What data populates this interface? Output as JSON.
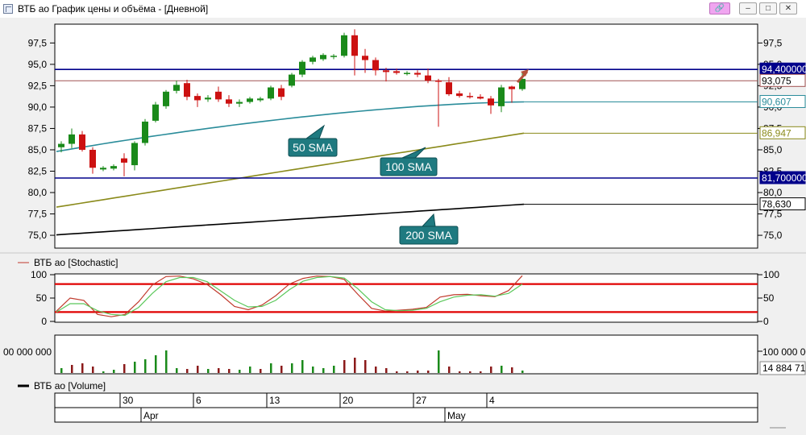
{
  "window": {
    "title": "ВТБ ао График цены и объёма - [Дневной]",
    "buttons": [
      "link",
      "minimize",
      "maximize",
      "close"
    ]
  },
  "colors": {
    "up_candle": "#1a8a1a",
    "down_candle": "#cc1111",
    "sma50": "#2a8c9a",
    "sma100": "#8a8a1a",
    "sma200": "#000000",
    "resistance": "#00008b",
    "stoch_k": "#c0392b",
    "stoch_d": "#5bc85b",
    "stoch_band": "#e00000",
    "callout_bg": "#1f7a80"
  },
  "chart_data": [
    {
      "type": "candlestick",
      "name": "price",
      "x_labels": [
        "30",
        "6",
        "13",
        "20",
        "27",
        "4"
      ],
      "month_labels": [
        "Apr",
        "May"
      ],
      "y_ticks": [
        "75,0",
        "77,5",
        "80,0",
        "82,5",
        "85,0",
        "87,5",
        "90,0",
        "92,5",
        "95,0",
        "97,5"
      ],
      "ylim": [
        73.5,
        99.7
      ],
      "candles": [
        {
          "o": 85.3,
          "h": 86.0,
          "l": 84.7,
          "c": 85.7
        },
        {
          "o": 85.7,
          "h": 87.5,
          "l": 85.2,
          "c": 86.8
        },
        {
          "o": 86.8,
          "h": 87.2,
          "l": 84.8,
          "c": 85.0
        },
        {
          "o": 85.0,
          "h": 85.3,
          "l": 82.2,
          "c": 82.9
        },
        {
          "o": 82.7,
          "h": 83.1,
          "l": 82.5,
          "c": 82.9
        },
        {
          "o": 82.8,
          "h": 83.3,
          "l": 82.6,
          "c": 83.1
        },
        {
          "o": 84.0,
          "h": 84.6,
          "l": 81.9,
          "c": 83.5
        },
        {
          "o": 83.2,
          "h": 86.0,
          "l": 82.6,
          "c": 85.8
        },
        {
          "o": 85.8,
          "h": 88.6,
          "l": 85.5,
          "c": 88.3
        },
        {
          "o": 88.4,
          "h": 90.6,
          "l": 88.2,
          "c": 90.3
        },
        {
          "o": 90.1,
          "h": 92.0,
          "l": 89.8,
          "c": 91.8
        },
        {
          "o": 91.9,
          "h": 93.1,
          "l": 91.6,
          "c": 92.6
        },
        {
          "o": 92.8,
          "h": 93.2,
          "l": 90.8,
          "c": 91.2
        },
        {
          "o": 91.3,
          "h": 91.6,
          "l": 90.0,
          "c": 90.8
        },
        {
          "o": 90.9,
          "h": 91.4,
          "l": 90.6,
          "c": 91.1
        },
        {
          "o": 91.8,
          "h": 92.4,
          "l": 90.6,
          "c": 90.9
        },
        {
          "o": 90.9,
          "h": 91.4,
          "l": 90.0,
          "c": 90.4
        },
        {
          "o": 90.4,
          "h": 90.9,
          "l": 90.0,
          "c": 90.6
        },
        {
          "o": 90.6,
          "h": 91.2,
          "l": 90.4,
          "c": 91.0
        },
        {
          "o": 90.8,
          "h": 91.2,
          "l": 90.6,
          "c": 91.0
        },
        {
          "o": 91.0,
          "h": 92.5,
          "l": 90.8,
          "c": 92.3
        },
        {
          "o": 92.2,
          "h": 92.6,
          "l": 90.8,
          "c": 91.2
        },
        {
          "o": 92.5,
          "h": 94.0,
          "l": 92.3,
          "c": 93.8
        },
        {
          "o": 93.8,
          "h": 95.5,
          "l": 93.5,
          "c": 95.3
        },
        {
          "o": 95.3,
          "h": 96.0,
          "l": 95.0,
          "c": 95.8
        },
        {
          "o": 95.6,
          "h": 96.3,
          "l": 95.4,
          "c": 96.1
        },
        {
          "o": 95.9,
          "h": 96.2,
          "l": 95.6,
          "c": 96.0
        },
        {
          "o": 96.0,
          "h": 98.7,
          "l": 95.8,
          "c": 98.4
        },
        {
          "o": 98.4,
          "h": 99.1,
          "l": 93.7,
          "c": 96.0
        },
        {
          "o": 96.0,
          "h": 96.8,
          "l": 94.0,
          "c": 95.5
        },
        {
          "o": 95.5,
          "h": 95.8,
          "l": 93.7,
          "c": 94.3
        },
        {
          "o": 94.3,
          "h": 94.6,
          "l": 93.0,
          "c": 94.1
        },
        {
          "o": 94.2,
          "h": 94.5,
          "l": 93.8,
          "c": 94.0
        },
        {
          "o": 93.9,
          "h": 94.2,
          "l": 93.7,
          "c": 94.0
        },
        {
          "o": 94.0,
          "h": 94.3,
          "l": 93.5,
          "c": 93.8
        },
        {
          "o": 93.7,
          "h": 94.5,
          "l": 92.8,
          "c": 93.1
        },
        {
          "o": 93.1,
          "h": 93.3,
          "l": 87.7,
          "c": 93.0
        },
        {
          "o": 92.9,
          "h": 93.5,
          "l": 91.3,
          "c": 91.5
        },
        {
          "o": 91.6,
          "h": 91.9,
          "l": 91.1,
          "c": 91.3
        },
        {
          "o": 91.3,
          "h": 91.7,
          "l": 91.0,
          "c": 91.2
        },
        {
          "o": 91.2,
          "h": 91.5,
          "l": 90.9,
          "c": 91.0
        },
        {
          "o": 91.0,
          "h": 91.3,
          "l": 89.2,
          "c": 90.2
        },
        {
          "o": 90.1,
          "h": 92.6,
          "l": 89.4,
          "c": 92.3
        },
        {
          "o": 92.4,
          "h": 92.5,
          "l": 90.5,
          "c": 92.1
        },
        {
          "o": 92.1,
          "h": 94.1,
          "l": 91.9,
          "c": 93.3
        }
      ],
      "sma50": {
        "label": "50 SMA",
        "start": 84.8,
        "end": 90.607,
        "value_label": "90,607"
      },
      "sma100": {
        "label": "100 SMA",
        "start": 78.3,
        "end": 86.947,
        "value_label": "86,947"
      },
      "sma200": {
        "label": "200 SMA",
        "start": 75.05,
        "end": 78.63,
        "value_label": "78,630"
      },
      "levels": [
        {
          "value": 94.4,
          "label": "94,400000",
          "style": "resistance"
        },
        {
          "value": 93.075,
          "label": "93,075",
          "style": "last-price"
        },
        {
          "value": 81.7,
          "label": "81,700000",
          "style": "resistance"
        }
      ]
    },
    {
      "type": "line",
      "name": "stochastic",
      "title": "ВТБ ао [Stochastic]",
      "y_ticks": [
        "0",
        "50",
        "100"
      ],
      "ylim": [
        0,
        100
      ],
      "bands": [
        20,
        80
      ],
      "series": [
        {
          "key": "k",
          "values": [
            22,
            50,
            45,
            15,
            10,
            15,
            42,
            78,
            96,
            97,
            91,
            79,
            57,
            32,
            25,
            35,
            55,
            80,
            92,
            97,
            96,
            90,
            58,
            28,
            22,
            24,
            26,
            30,
            52,
            57,
            58,
            55,
            53,
            66,
            98
          ]
        },
        {
          "key": "d",
          "values": [
            20,
            38,
            38,
            23,
            15,
            13,
            30,
            60,
            85,
            94,
            94,
            85,
            65,
            45,
            31,
            32,
            45,
            68,
            86,
            94,
            96,
            93,
            70,
            42,
            25,
            23,
            24,
            28,
            42,
            52,
            56,
            57,
            54,
            60,
            80
          ]
        }
      ]
    },
    {
      "type": "bar",
      "name": "volume",
      "title": "ВТБ ао [Volume]",
      "y_tick_label": "100 000 000",
      "left_tick_label": "00 000 000",
      "last_value_label": "14 884 71",
      "ylim": [
        0,
        230000000
      ],
      "bars": [
        {
          "v": 30000000,
          "up": true
        },
        {
          "v": 50000000,
          "up": false
        },
        {
          "v": 60000000,
          "up": false
        },
        {
          "v": 40000000,
          "up": false
        },
        {
          "v": 10000000,
          "up": true
        },
        {
          "v": 20000000,
          "up": true
        },
        {
          "v": 55000000,
          "up": false
        },
        {
          "v": 70000000,
          "up": true
        },
        {
          "v": 85000000,
          "up": true
        },
        {
          "v": 110000000,
          "up": true
        },
        {
          "v": 140000000,
          "up": true
        },
        {
          "v": 30000000,
          "up": true
        },
        {
          "v": 25000000,
          "up": false
        },
        {
          "v": 45000000,
          "up": false
        },
        {
          "v": 25000000,
          "up": true
        },
        {
          "v": 30000000,
          "up": false
        },
        {
          "v": 25000000,
          "up": false
        },
        {
          "v": 20000000,
          "up": true
        },
        {
          "v": 40000000,
          "up": true
        },
        {
          "v": 25000000,
          "up": false
        },
        {
          "v": 60000000,
          "up": true
        },
        {
          "v": 45000000,
          "up": false
        },
        {
          "v": 60000000,
          "up": true
        },
        {
          "v": 80000000,
          "up": true
        },
        {
          "v": 40000000,
          "up": true
        },
        {
          "v": 30000000,
          "up": true
        },
        {
          "v": 45000000,
          "up": true
        },
        {
          "v": 80000000,
          "up": false
        },
        {
          "v": 95000000,
          "up": false
        },
        {
          "v": 80000000,
          "up": false
        },
        {
          "v": 40000000,
          "up": false
        },
        {
          "v": 30000000,
          "up": false
        },
        {
          "v": 10000000,
          "up": false
        },
        {
          "v": 10000000,
          "up": false
        },
        {
          "v": 15000000,
          "up": false
        },
        {
          "v": 15000000,
          "up": false
        },
        {
          "v": 140000000,
          "up": true
        },
        {
          "v": 40000000,
          "up": false
        },
        {
          "v": 10000000,
          "up": false
        },
        {
          "v": 10000000,
          "up": false
        },
        {
          "v": 10000000,
          "up": false
        },
        {
          "v": 40000000,
          "up": false
        },
        {
          "v": 45000000,
          "up": true
        },
        {
          "v": 35000000,
          "up": false
        },
        {
          "v": 15000000,
          "up": true
        }
      ]
    }
  ]
}
